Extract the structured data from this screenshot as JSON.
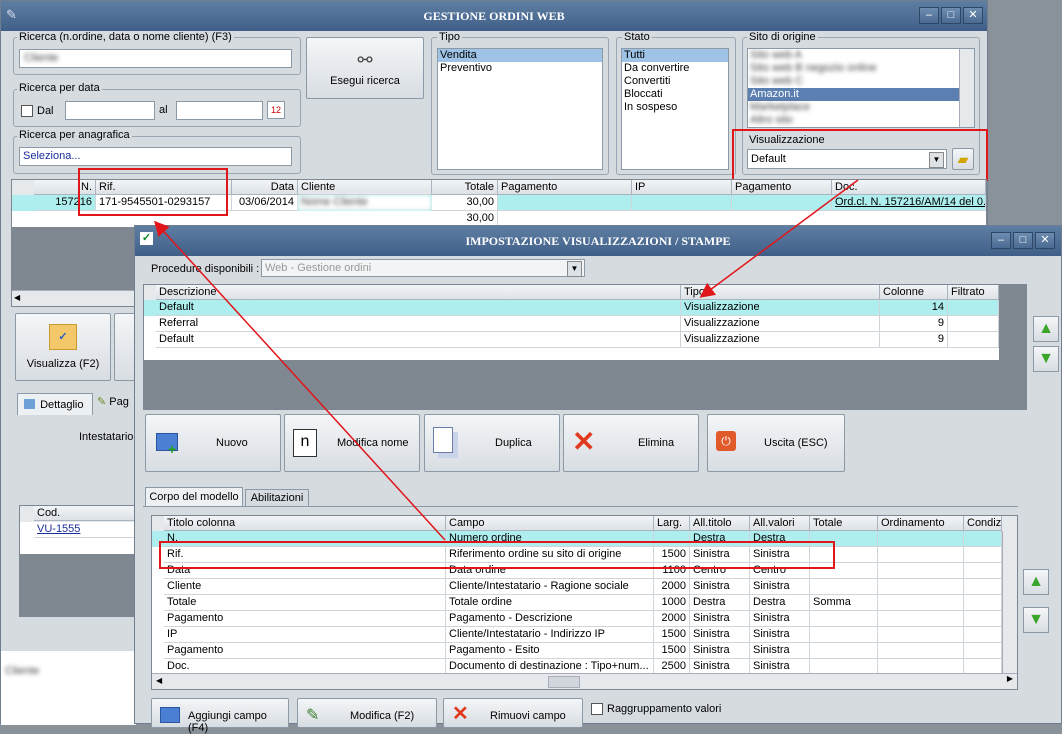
{
  "main": {
    "title": "GESTIONE ORDINI WEB",
    "search_label": "Ricerca (n.ordine, data o nome cliente) (F3)",
    "search_value": "Cliente",
    "date_search_label": "Ricerca per data",
    "from_label": "Dal",
    "to_label": "al",
    "anag_label": "Ricerca per anagrafica",
    "anag_value": "Seleziona...",
    "search_button": "Esegui ricerca",
    "tipo_label": "Tipo",
    "tipo_items": [
      "Vendita",
      "Preventivo"
    ],
    "stato_label": "Stato",
    "stato_items": [
      "Tutti",
      "Da convertire",
      "Convertiti",
      "Bloccati",
      "In sospeso"
    ],
    "sito_label": "Sito di origine",
    "sito_items": [
      "Sito web A",
      "Sito web B negozio online",
      "Sito web C",
      "Amazon.it",
      "Marketplace",
      "Altro sito"
    ],
    "visual_label": "Visualizzazione",
    "visual_value": "Default",
    "table_headers": [
      "N.",
      "Rif.",
      "Data",
      "Cliente",
      "Totale",
      "Pagamento",
      "IP",
      "Pagamento",
      "Doc."
    ],
    "table_rows": [
      [
        "157216",
        "171-9545501-0293157",
        "03/06/2014",
        "Nome Cliente",
        "30,00",
        "",
        "",
        "",
        "Ord.cl. N. 157216/AM/14 del 0..."
      ],
      [
        "",
        "",
        "",
        "",
        "30,00",
        "",
        "",
        "",
        ""
      ]
    ],
    "visualizza_button": "Visualizza (F2)",
    "tab_dettaglio": "Dettaglio",
    "tab_pag": "Pag",
    "intestatario_label": "Intestatario",
    "cod_header": "Cod.",
    "cod_value": "VU-1555",
    "blur_text": "Cliente"
  },
  "dialog": {
    "title": "IMPOSTAZIONE VISUALIZZAZIONI / STAMPE",
    "procedure_label": "Procedure disponibili :",
    "procedure_value": "Web - Gestione ordini",
    "views_headers": [
      "Descrizione",
      "Tipo",
      "Colonne",
      "Filtrato"
    ],
    "views_rows": [
      [
        "Default",
        "Visualizzazione",
        "14",
        ""
      ],
      [
        "Referral",
        "Visualizzazione",
        "9",
        ""
      ],
      [
        "Default",
        "Visualizzazione",
        "9",
        ""
      ]
    ],
    "btn_nuovo": "Nuovo",
    "btn_modifica": "Modifica nome",
    "btn_duplica": "Duplica",
    "btn_elimina": "Elimina",
    "btn_uscita": "Uscita (ESC)",
    "tab_corpo": "Corpo del modello",
    "tab_abil": "Abilitazioni",
    "fields_headers": [
      "Titolo colonna",
      "Campo",
      "Larg.",
      "All.titolo",
      "All.valori",
      "Totale",
      "Ordinamento",
      "Condiz"
    ],
    "fields_rows": [
      [
        "N.",
        "Numero ordine",
        "",
        "Destra",
        "Destra",
        "",
        "",
        ""
      ],
      [
        "Rif.",
        "Riferimento ordine su sito di origine",
        "1500",
        "Sinistra",
        "Sinistra",
        "",
        "",
        ""
      ],
      [
        "Data",
        "Data ordine",
        "1100",
        "Centro",
        "Centro",
        "",
        "",
        ""
      ],
      [
        "Cliente",
        "Cliente/Intestatario - Ragione sociale",
        "2000",
        "Sinistra",
        "Sinistra",
        "",
        "",
        ""
      ],
      [
        "Totale",
        "Totale ordine",
        "1000",
        "Destra",
        "Destra",
        "Somma",
        "",
        ""
      ],
      [
        "Pagamento",
        "Pagamento - Descrizione",
        "2000",
        "Sinistra",
        "Sinistra",
        "",
        "",
        ""
      ],
      [
        "IP",
        "Cliente/Intestatario - Indirizzo IP",
        "1500",
        "Sinistra",
        "Sinistra",
        "",
        "",
        ""
      ],
      [
        "Pagamento",
        "Pagamento - Esito",
        "1500",
        "Sinistra",
        "Sinistra",
        "",
        "",
        ""
      ],
      [
        "Doc.",
        "Documento di destinazione : Tipo+num...",
        "2500",
        "Sinistra",
        "Sinistra",
        "",
        "",
        ""
      ]
    ],
    "btn_aggiungi": "Aggiungi campo (F4)",
    "btn_modifica_campo": "Modifica (F2)",
    "btn_rimuovi": "Rimuovi campo",
    "raggruppamento": "Raggruppamento valori"
  },
  "colors": {
    "highlight": "#aeeeee",
    "selection": "#9fc3e6",
    "annotation_red": "#e0161b",
    "title_blue": "#3f5f88"
  }
}
